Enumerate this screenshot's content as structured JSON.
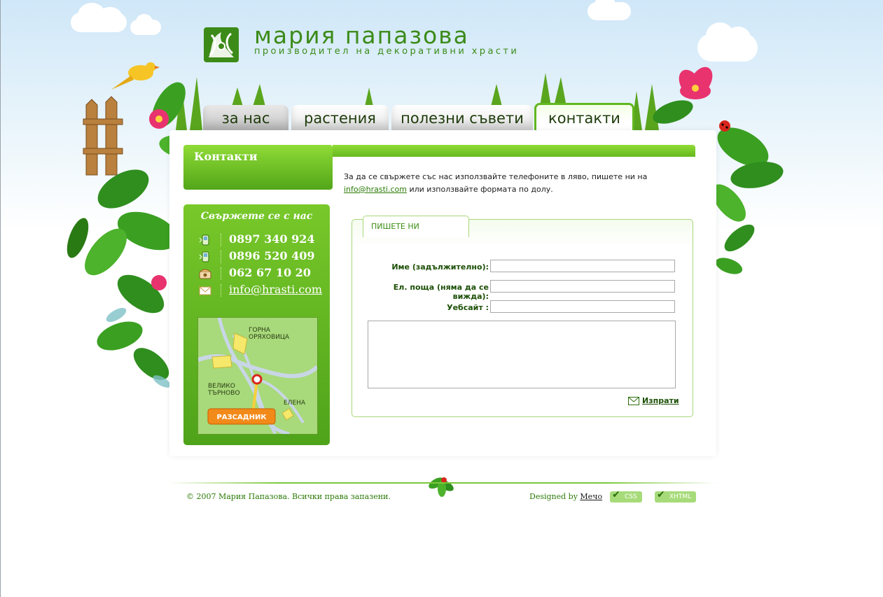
{
  "brand": {
    "name": "мария папазова",
    "tagline": "производител на декоративни храсти"
  },
  "nav": [
    {
      "label": "за нас"
    },
    {
      "label": "растения"
    },
    {
      "label": "полезни съвети"
    },
    {
      "label": "контакти"
    }
  ],
  "page": {
    "title": "Контакти",
    "intro_before": "За да се свържете със нас използвайте телефоните в ляво, пишете ни на ",
    "intro_email": "info@hrasti.com",
    "intro_after": " или използвайте формата по долу."
  },
  "contact_box": {
    "title": "Свържете се с нас",
    "items": [
      {
        "icon": "mobile-phone-icon",
        "text": "0897 340 924"
      },
      {
        "icon": "mobile-phone-icon",
        "text": "0896 520 409"
      },
      {
        "icon": "landline-phone-icon",
        "text": "062 67 10 20"
      },
      {
        "icon": "envelope-icon",
        "text": "info@hrasti.com"
      }
    ]
  },
  "map": {
    "towns": [
      "ГОРНА ОРЯХОВИЦА",
      "ВЕЛИКО ТЪРНОВО",
      "ЕЛЕНА"
    ],
    "marker_label": "РАЗСАДНИК"
  },
  "form": {
    "tab_label": "ПИШЕТЕ НИ",
    "name_label": "Име (задължително):",
    "email_label": "Ел. поща (няма да се вижда):",
    "website_label": "Уебсайт :",
    "name_value": "",
    "email_value": "",
    "website_value": "",
    "message_value": "",
    "submit_label": "Изпрати"
  },
  "footer": {
    "copyright": "© 2007 Мария Папазова. Всички права запазени.",
    "designed_by": "Designed by ",
    "designer": "Мечо",
    "badges": [
      "CSS",
      "XHTML"
    ]
  },
  "colors": {
    "brand_green": "#3c8b18",
    "box_green": "#5fb221",
    "link_green": "#2c7b08"
  }
}
